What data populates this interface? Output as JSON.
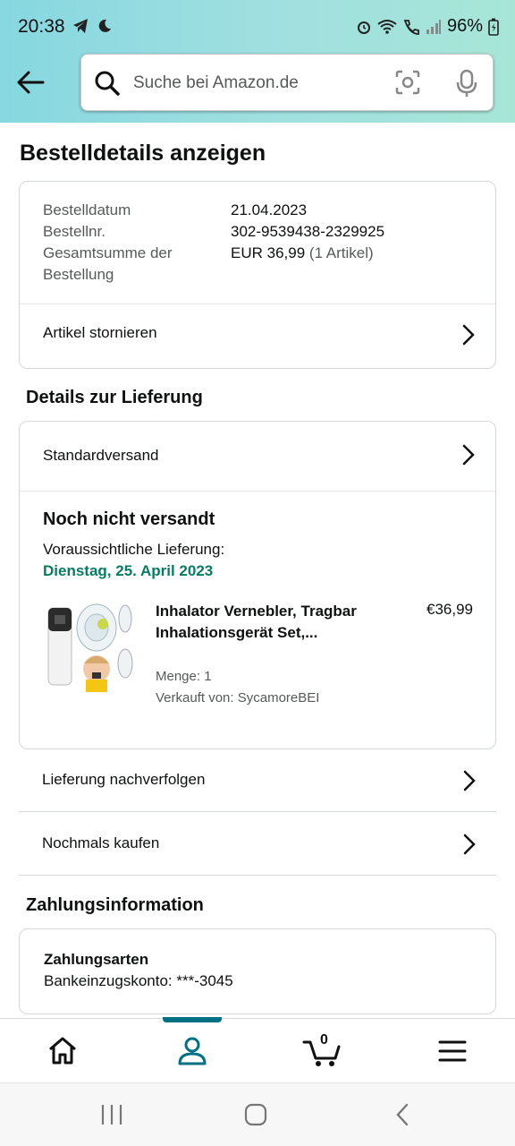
{
  "status_bar": {
    "time": "20:38",
    "battery": "96%"
  },
  "search": {
    "placeholder": "Suche bei Amazon.de"
  },
  "page": {
    "title": "Bestelldetails anzeigen"
  },
  "order_info": {
    "rows": [
      {
        "label": "Bestelldatum",
        "value": "21.04.2023"
      },
      {
        "label": "Bestellnr.",
        "value": "302-9539438-2329925"
      },
      {
        "label": "Gesamtsumme der Bestellung",
        "value": "EUR 36,99",
        "value_extra": "(1 Artikel)"
      }
    ],
    "cancel_label": "Artikel stornieren"
  },
  "delivery": {
    "section_title": "Details zur Lieferung",
    "shipping_method": "Standardversand",
    "status_title": "Noch nicht versandt",
    "eta_label": "Voraussichtliche Lieferung:",
    "eta_date": "Dienstag, 25. April 2023",
    "product": {
      "name": "Inhalator Vernebler, Tragbar Inhalationsgerät Set,...",
      "price": "€36,99",
      "quantity": "Menge: 1",
      "seller": "Verkauft von: SycamoreBEI"
    },
    "track_label": "Lieferung nachverfolgen",
    "buy_again_label": "Nochmals kaufen"
  },
  "payment": {
    "section_title": "Zahlungsinformation",
    "methods_title": "Zahlungsarten",
    "method_value": "Bankeinzugskonto: ***-3045"
  },
  "bottom_nav": {
    "cart_count": "0",
    "active": "account"
  },
  "colors": {
    "accent": "#007185",
    "eta_green": "#067d62",
    "header_gradient_start": "#86d7e0",
    "header_gradient_end": "#a7e6d7"
  }
}
